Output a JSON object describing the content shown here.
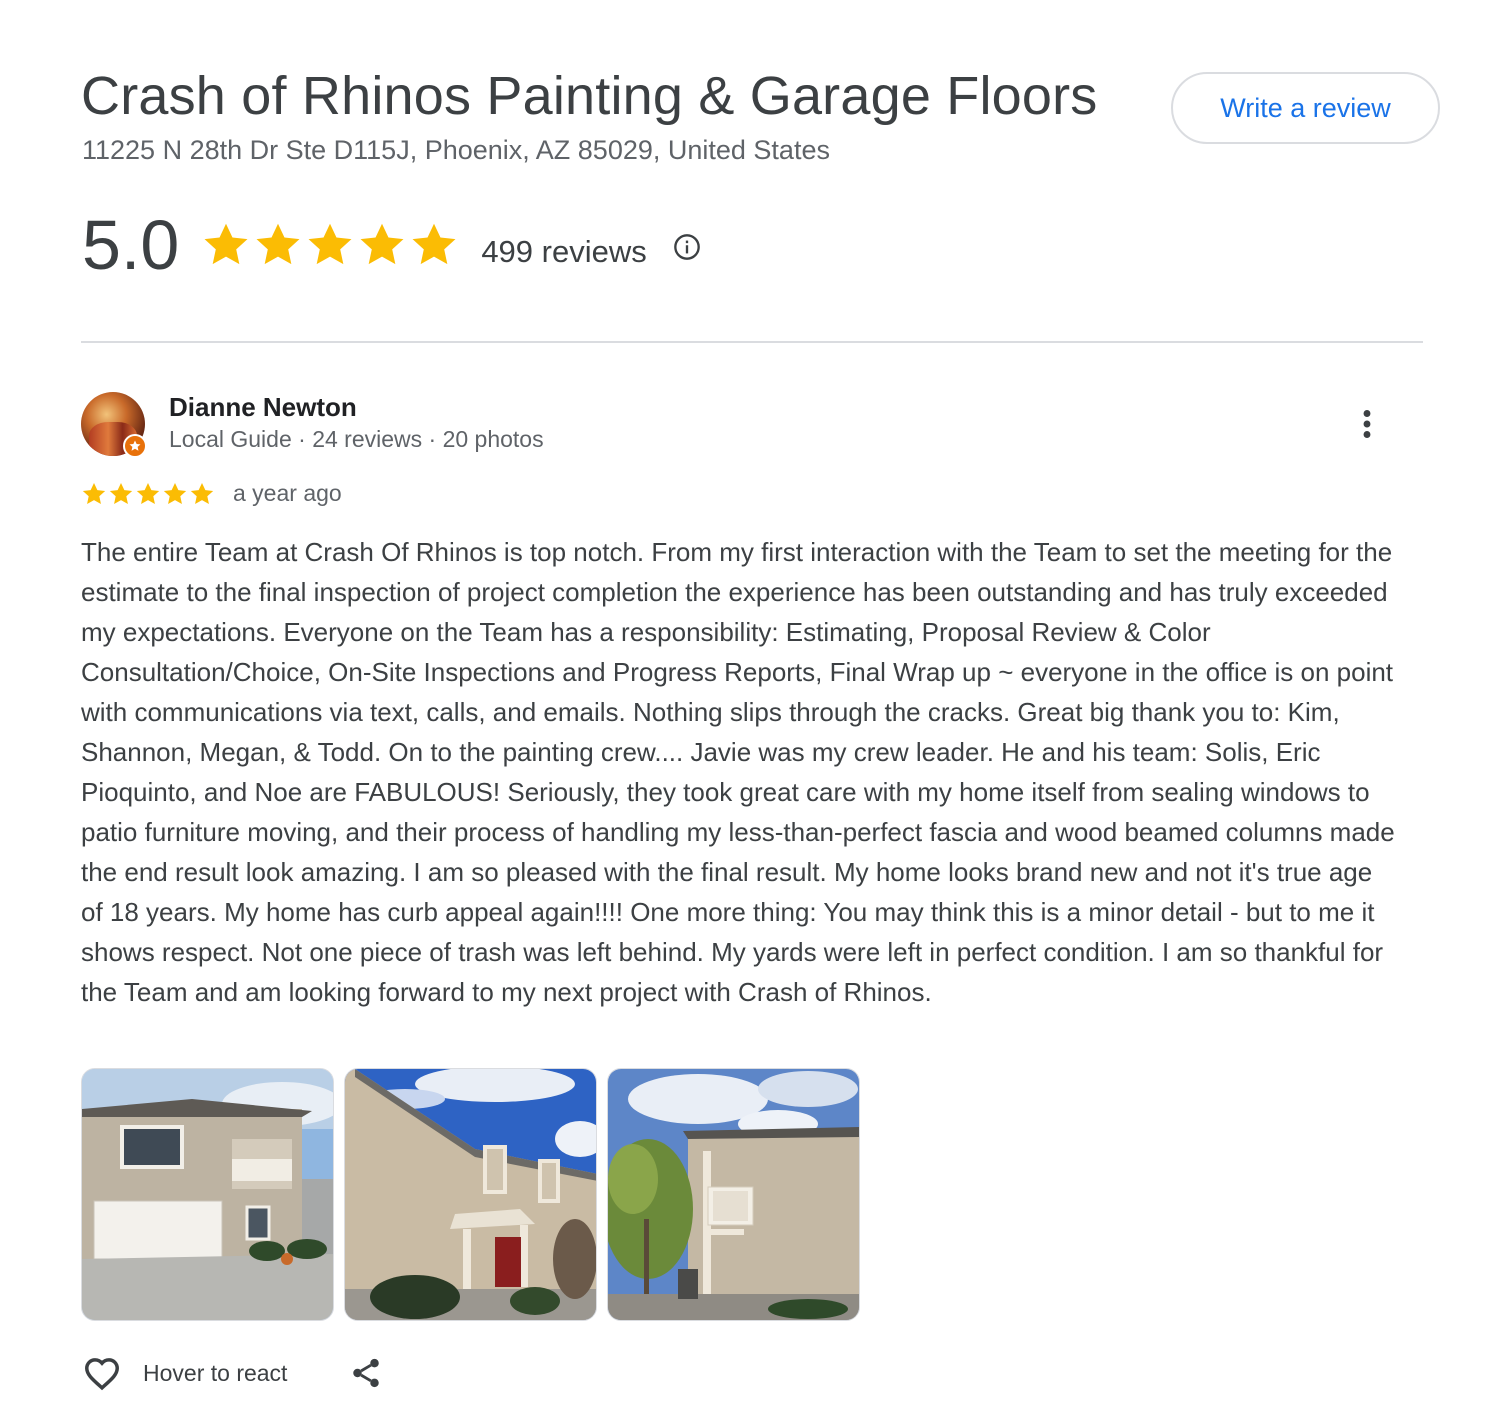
{
  "business": {
    "name": "Crash of Rhinos Painting & Garage Floors",
    "address": "11225 N 28th Dr Ste D115J, Phoenix, AZ 85029, United States",
    "write_review_label": "Write a review",
    "rating": "5.0",
    "stars": 5,
    "review_count_label": "499 reviews",
    "info_icon": "info-icon"
  },
  "review": {
    "author": "Dianne Newton",
    "author_meta": "Local Guide · 24 reviews · 20 photos",
    "stars": 5,
    "date": "a year ago",
    "text": "The entire Team at Crash Of Rhinos is top notch. From my first interaction with the Team to set the meeting for the estimate to the final inspection of project completion the experience has been outstanding and has truly exceeded my expectations. Everyone on the Team has a responsibility: Estimating, Proposal Review & Color Consultation/Choice, On-Site Inspections and Progress Reports, Final Wrap up ~ everyone in the office is on point with communications via text, calls, and emails. Nothing slips through the cracks. Great big thank you to: Kim, Shannon, Megan, & Todd. On to the painting crew.... Javie was my crew leader. He and his team: Solis, Eric Pioquinto, and Noe are FABULOUS! Seriously, they took great care with my home itself from sealing windows to patio furniture moving, and their process of handling my less-than-perfect fascia and wood beamed columns made the end result look amazing. I am so pleased with the final result. My home looks brand new and not it's true age of 18 years. My home has curb appeal again!!!! One more thing: You may think this is a minor detail - but to me it shows respect. Not one piece of trash was left behind. My yards were left in perfect condition. I am so thankful for the Team and am looking forward to my next project with Crash of Rhinos.",
    "photo_count": 3,
    "react_label": "Hover to react"
  },
  "colors": {
    "star": "#fbbc04",
    "link": "#1a73e8",
    "local_guide_badge": "#e8710a"
  },
  "icons": [
    "star-icon",
    "info-icon",
    "more-vert-icon",
    "heart-icon",
    "share-icon",
    "local-guide-badge-icon"
  ]
}
